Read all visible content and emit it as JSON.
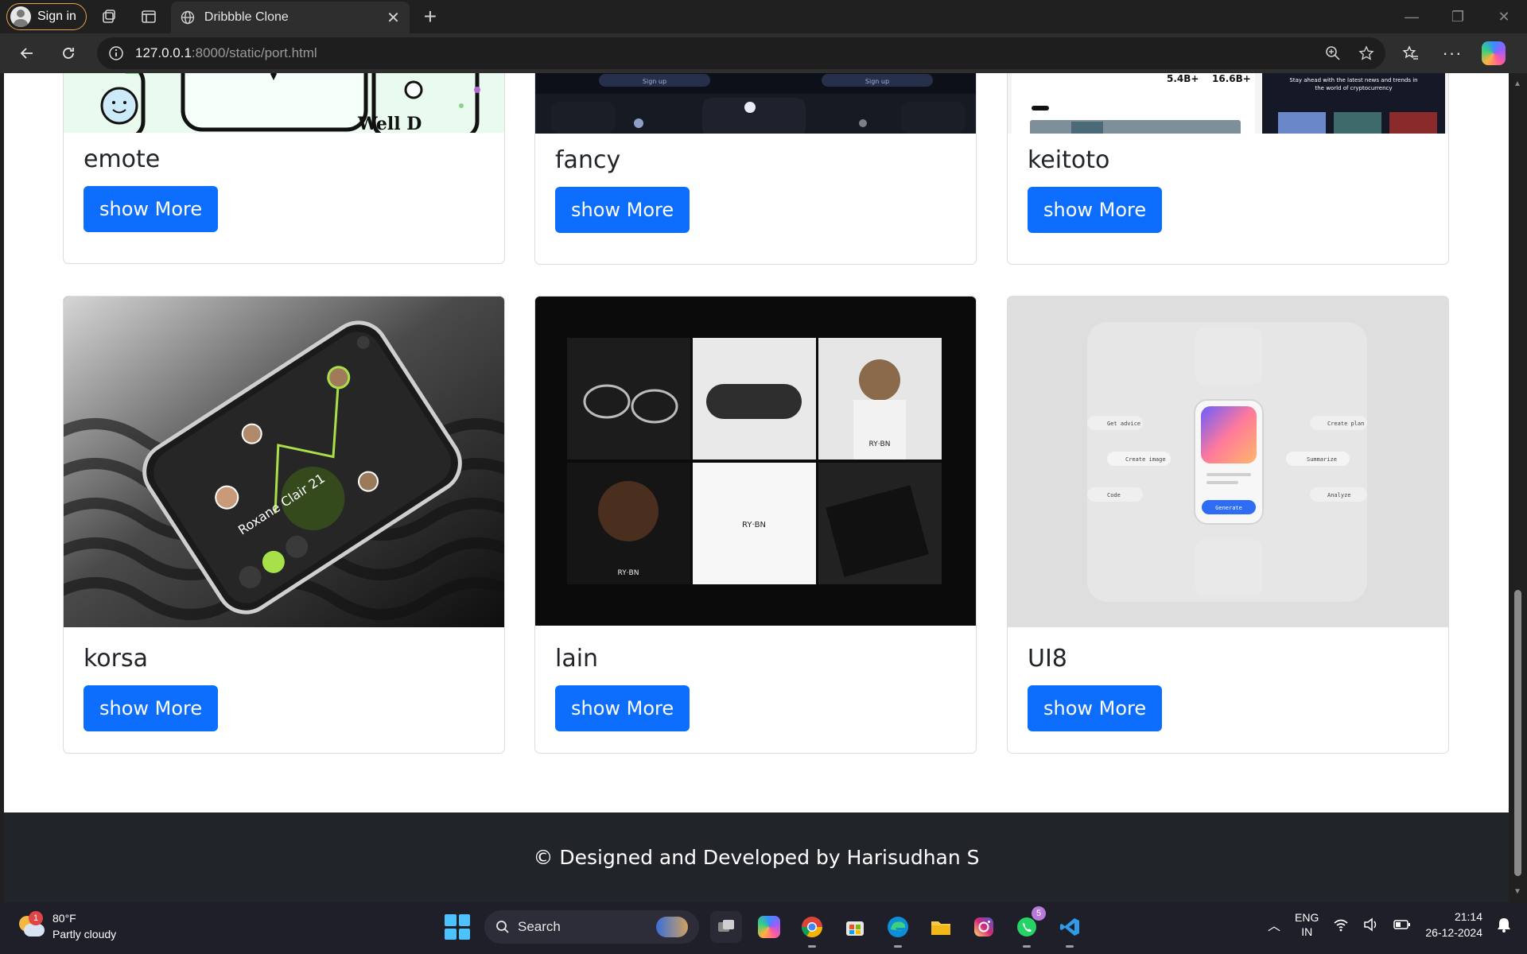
{
  "browser": {
    "sign_in": "Sign in",
    "tab_title": "Dribbble Clone",
    "url_host": "127.0.0.1",
    "url_path": ":8000/static/port.html"
  },
  "cards": [
    {
      "title": "emote",
      "button": "show More"
    },
    {
      "title": "fancy",
      "button": "show More"
    },
    {
      "title": "keitoto",
      "button": "show More"
    },
    {
      "title": "korsa",
      "button": "show More"
    },
    {
      "title": "lain",
      "button": "show More"
    },
    {
      "title": "UI8",
      "button": "show More"
    }
  ],
  "card_images": {
    "fancy_signup": "Sign up",
    "keitoto_stat1": "5.4B+",
    "keitoto_stat2": "16.6B+",
    "lain_brand": "RY·BN",
    "ui8_items": [
      "Get advice",
      "Create image",
      "Code",
      "Create plan",
      "Summarize",
      "Analyze"
    ],
    "ui8_button": "Generate"
  },
  "footer": {
    "text": "© Designed and Developed by Harisudhan S"
  },
  "taskbar": {
    "weather_temp": "80°F",
    "weather_desc": "Partly cloudy",
    "weather_badge": "1",
    "search": "Search",
    "whatsapp_badge": "5",
    "lang_line1": "ENG",
    "lang_line2": "IN",
    "time": "21:14",
    "date": "26-12-2024"
  }
}
